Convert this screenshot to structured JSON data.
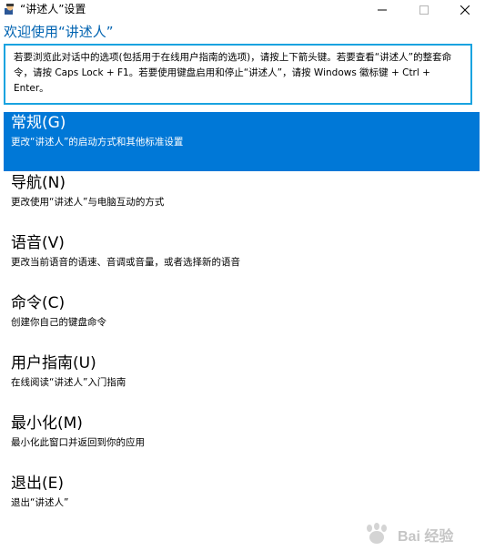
{
  "window": {
    "title": "“讲述人”设置",
    "minimize_icon": "minimize-icon",
    "maximize_icon": "maximize-icon",
    "close_icon": "close-icon"
  },
  "header": {
    "title": "欢迎使用“讲述人”",
    "instructions": "若要浏览此对话中的选项(包括用于在线用户指南的选项)，请按上下箭头键。若要查看“讲述人”的整套命令，请按 Caps Lock + F1。若要使用键盘启用和停止“讲述人”，请按 Windows 徽标键 + Ctrl + Enter。"
  },
  "menu": {
    "items": [
      {
        "label": "常规(G)",
        "desc": "更改“讲述人”的启动方式和其他标准设置",
        "selected": true
      },
      {
        "label": "导航(N)",
        "desc": "更改使用“讲述人”与电脑互动的方式"
      },
      {
        "label": "语音(V)",
        "desc": "更改当前语音的语速、音调或音量，或者选择新的语音"
      },
      {
        "label": "命令(C)",
        "desc": "创建你自己的键盘命令"
      },
      {
        "label": "用户指南(U)",
        "desc": "在线阅读“讲述人”入门指南"
      },
      {
        "label": "最小化(M)",
        "desc": "最小化此窗口并返回到你的应用"
      },
      {
        "label": "退出(E)",
        "desc": "退出“讲述人”"
      }
    ]
  },
  "watermark": {
    "text": "Bai 经验",
    "logo": "baidu-paw-logo"
  },
  "colors": {
    "accent": "#0078d7",
    "title": "#0063b1",
    "focus_border": "#19a3e0"
  }
}
